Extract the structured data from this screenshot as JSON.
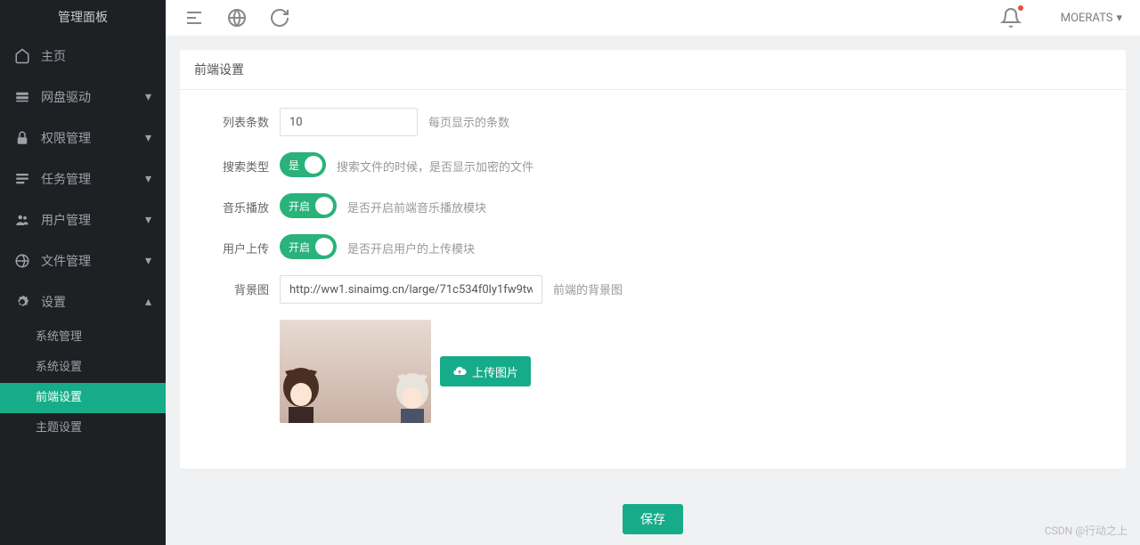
{
  "sidebar": {
    "title": "管理面板",
    "items": [
      {
        "icon": "home",
        "label": "主页"
      },
      {
        "icon": "drive",
        "label": "网盘驱动"
      },
      {
        "icon": "lock",
        "label": "权限管理"
      },
      {
        "icon": "task",
        "label": "任务管理"
      },
      {
        "icon": "users",
        "label": "用户管理"
      },
      {
        "icon": "file",
        "label": "文件管理"
      },
      {
        "icon": "gear",
        "label": "设置"
      }
    ],
    "subs": [
      {
        "label": "系统管理"
      },
      {
        "label": "系统设置"
      },
      {
        "label": "前端设置"
      },
      {
        "label": "主题设置"
      }
    ]
  },
  "header": {
    "username": "MOERATS"
  },
  "panel": {
    "title": "前端设置",
    "fields": {
      "list_count": {
        "label": "列表条数",
        "value": "10",
        "hint": "每页显示的条数"
      },
      "search_type": {
        "label": "搜索类型",
        "toggle": "是",
        "hint": "搜索文件的时候，是否显示加密的文件"
      },
      "music_play": {
        "label": "音乐播放",
        "toggle": "开启",
        "hint": "是否开启前端音乐播放模块"
      },
      "user_upload": {
        "label": "用户上传",
        "toggle": "开启",
        "hint": "是否开启用户的上传模块"
      },
      "background": {
        "label": "背景图",
        "value": "http://ww1.sinaimg.cn/large/71c534f0ly1fw9tw",
        "hint": "前端的背景图"
      }
    },
    "upload_btn": "上传图片",
    "save_btn": "保存"
  },
  "watermark": "CSDN @行动之上"
}
